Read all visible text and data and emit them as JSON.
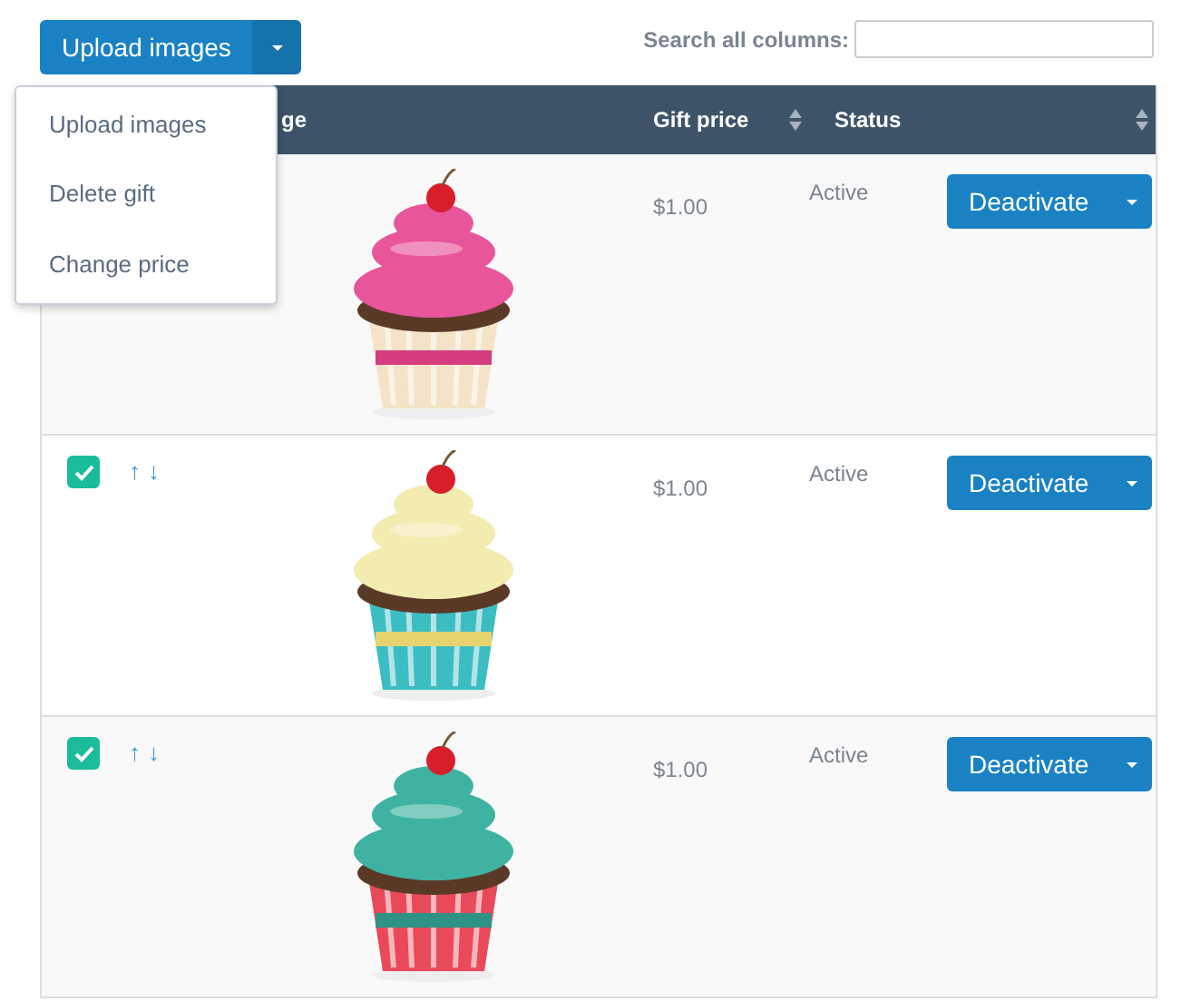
{
  "toolbar": {
    "upload_button": "Upload images",
    "search": {
      "label": "Search all columns:"
    }
  },
  "menu": {
    "items": [
      "Upload images",
      "Delete gift",
      "Change price"
    ]
  },
  "table": {
    "columns": [
      {
        "label": "ge",
        "sortable": false
      },
      {
        "label": "Gift price",
        "sortable": true
      },
      {
        "label": "Status",
        "sortable": false
      },
      {
        "sortable": true
      }
    ],
    "rows": [
      {
        "price": "$1.00",
        "status": "Active",
        "action": "Deactivate"
      },
      {
        "checked": true,
        "up": "↑",
        "down": "↓",
        "price": "$1.00",
        "status": "Active",
        "action": "Deactivate"
      },
      {
        "checked": true,
        "up": "↑",
        "down": "↓",
        "price": "$1.00",
        "status": "Active",
        "action": "Deactivate"
      }
    ]
  }
}
